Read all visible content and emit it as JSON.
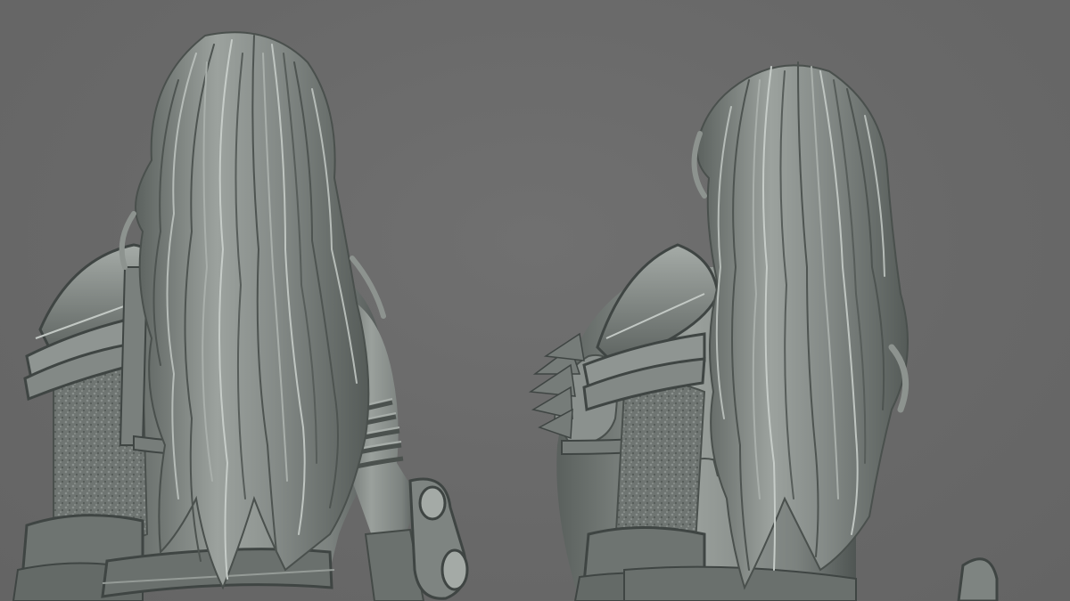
{
  "scene": {
    "background_color": "#6a6a6a",
    "material": {
      "base": "#8a908d",
      "light": "#b9bfbb",
      "shadow": "#4a4f4d",
      "deep": "#353938"
    },
    "figures": [
      {
        "id": "figure-back-view",
        "view": "back"
      },
      {
        "id": "figure-three-quarter-view",
        "view": "three-quarter-back"
      }
    ]
  }
}
